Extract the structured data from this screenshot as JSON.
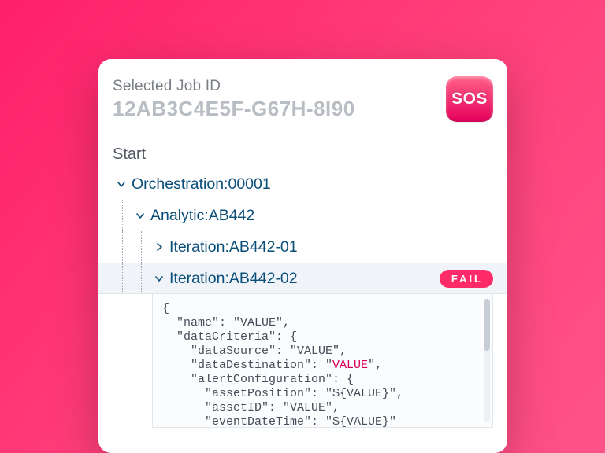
{
  "header": {
    "label": "Selected Job ID",
    "job_id": "12AB3C4E5F-G67H-8I90",
    "sos": "SOS"
  },
  "start_label": "Start",
  "tree": {
    "orchestration": {
      "prefix": "Orchestration: ",
      "id": "00001"
    },
    "analytic": {
      "prefix": "Analytic: ",
      "id": "AB442"
    },
    "iteration1": {
      "prefix": "Iteration: ",
      "id": "AB442-01"
    },
    "iteration2": {
      "prefix": "Iteration: ",
      "id": "AB442-02",
      "status": "FAIL"
    }
  },
  "code": {
    "l1": "{",
    "l2": "  \"name\": \"VALUE\",",
    "l3": "  \"dataCriteria\": {",
    "l4": "    \"dataSource\": \"VALUE\",",
    "l5a": "    \"dataDestination\": \"",
    "l5b": "VALUE",
    "l5c": "\",",
    "l6": "    \"alertConfiguration\": {",
    "l7": "      \"assetPosition\": \"${VALUE}\",",
    "l8": "      \"assetID\": \"VALUE\",",
    "l9": "      \"eventDateTime\": \"${VALUE}\""
  },
  "colors": {
    "accent_pink": "#ff2a68",
    "text_navy": "#0a4e7a"
  }
}
